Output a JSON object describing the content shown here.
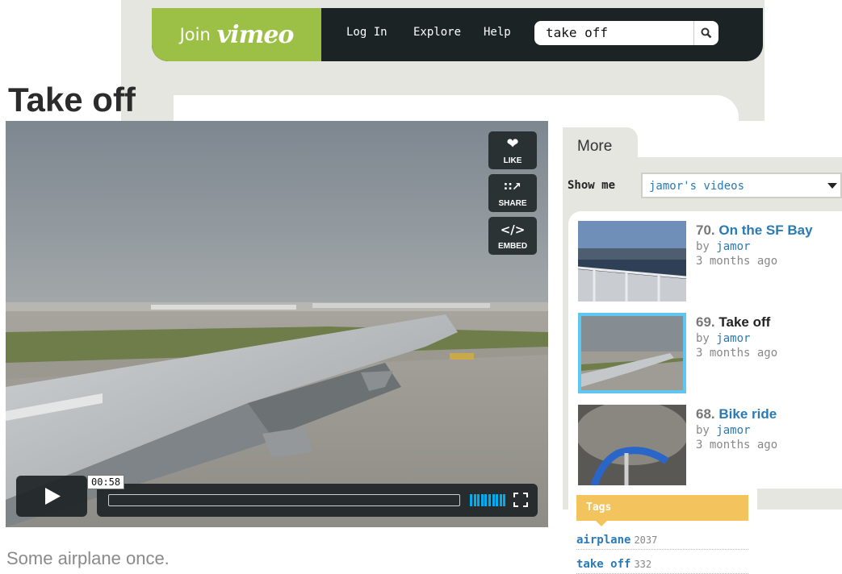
{
  "header": {
    "join_word": "Join",
    "brand": "vimeo",
    "nav": [
      "Log In",
      "Explore",
      "Help"
    ],
    "search_value": "take off",
    "colors": {
      "brand_green": "#9bc045",
      "nav_dark": "#1c2325"
    }
  },
  "page": {
    "title": "Take off",
    "description": "Some airplane once."
  },
  "player": {
    "side_buttons": [
      {
        "label": "LIKE",
        "icon": "heart-icon"
      },
      {
        "label": "SHARE",
        "icon": "share-icon"
      },
      {
        "label": "EMBED",
        "icon": "embed-icon"
      }
    ],
    "timecode": "00:58",
    "progress_fraction": 0.0,
    "volume_bars": 10,
    "fullscreen_icon": "fullscreen-icon",
    "play_icon": "play-icon",
    "accent": "#00adef"
  },
  "sidebar": {
    "tab": "More",
    "show_me_label": "Show me",
    "show_me_value": "jamor's videos",
    "videos": [
      {
        "num": "70.",
        "title": "On the SF Bay",
        "by": "by",
        "user": "jamor",
        "age": "3 months ago",
        "current": false
      },
      {
        "num": "69.",
        "title": "Take off",
        "by": "by",
        "user": "jamor",
        "age": "3 months ago",
        "current": true
      },
      {
        "num": "68.",
        "title": "Bike ride",
        "by": "by",
        "user": "jamor",
        "age": "3 months ago",
        "current": false
      }
    ],
    "tags_title": "Tags",
    "tags": [
      {
        "name": "airplane",
        "count": "2037"
      },
      {
        "name": "take off",
        "count": "332"
      }
    ]
  }
}
